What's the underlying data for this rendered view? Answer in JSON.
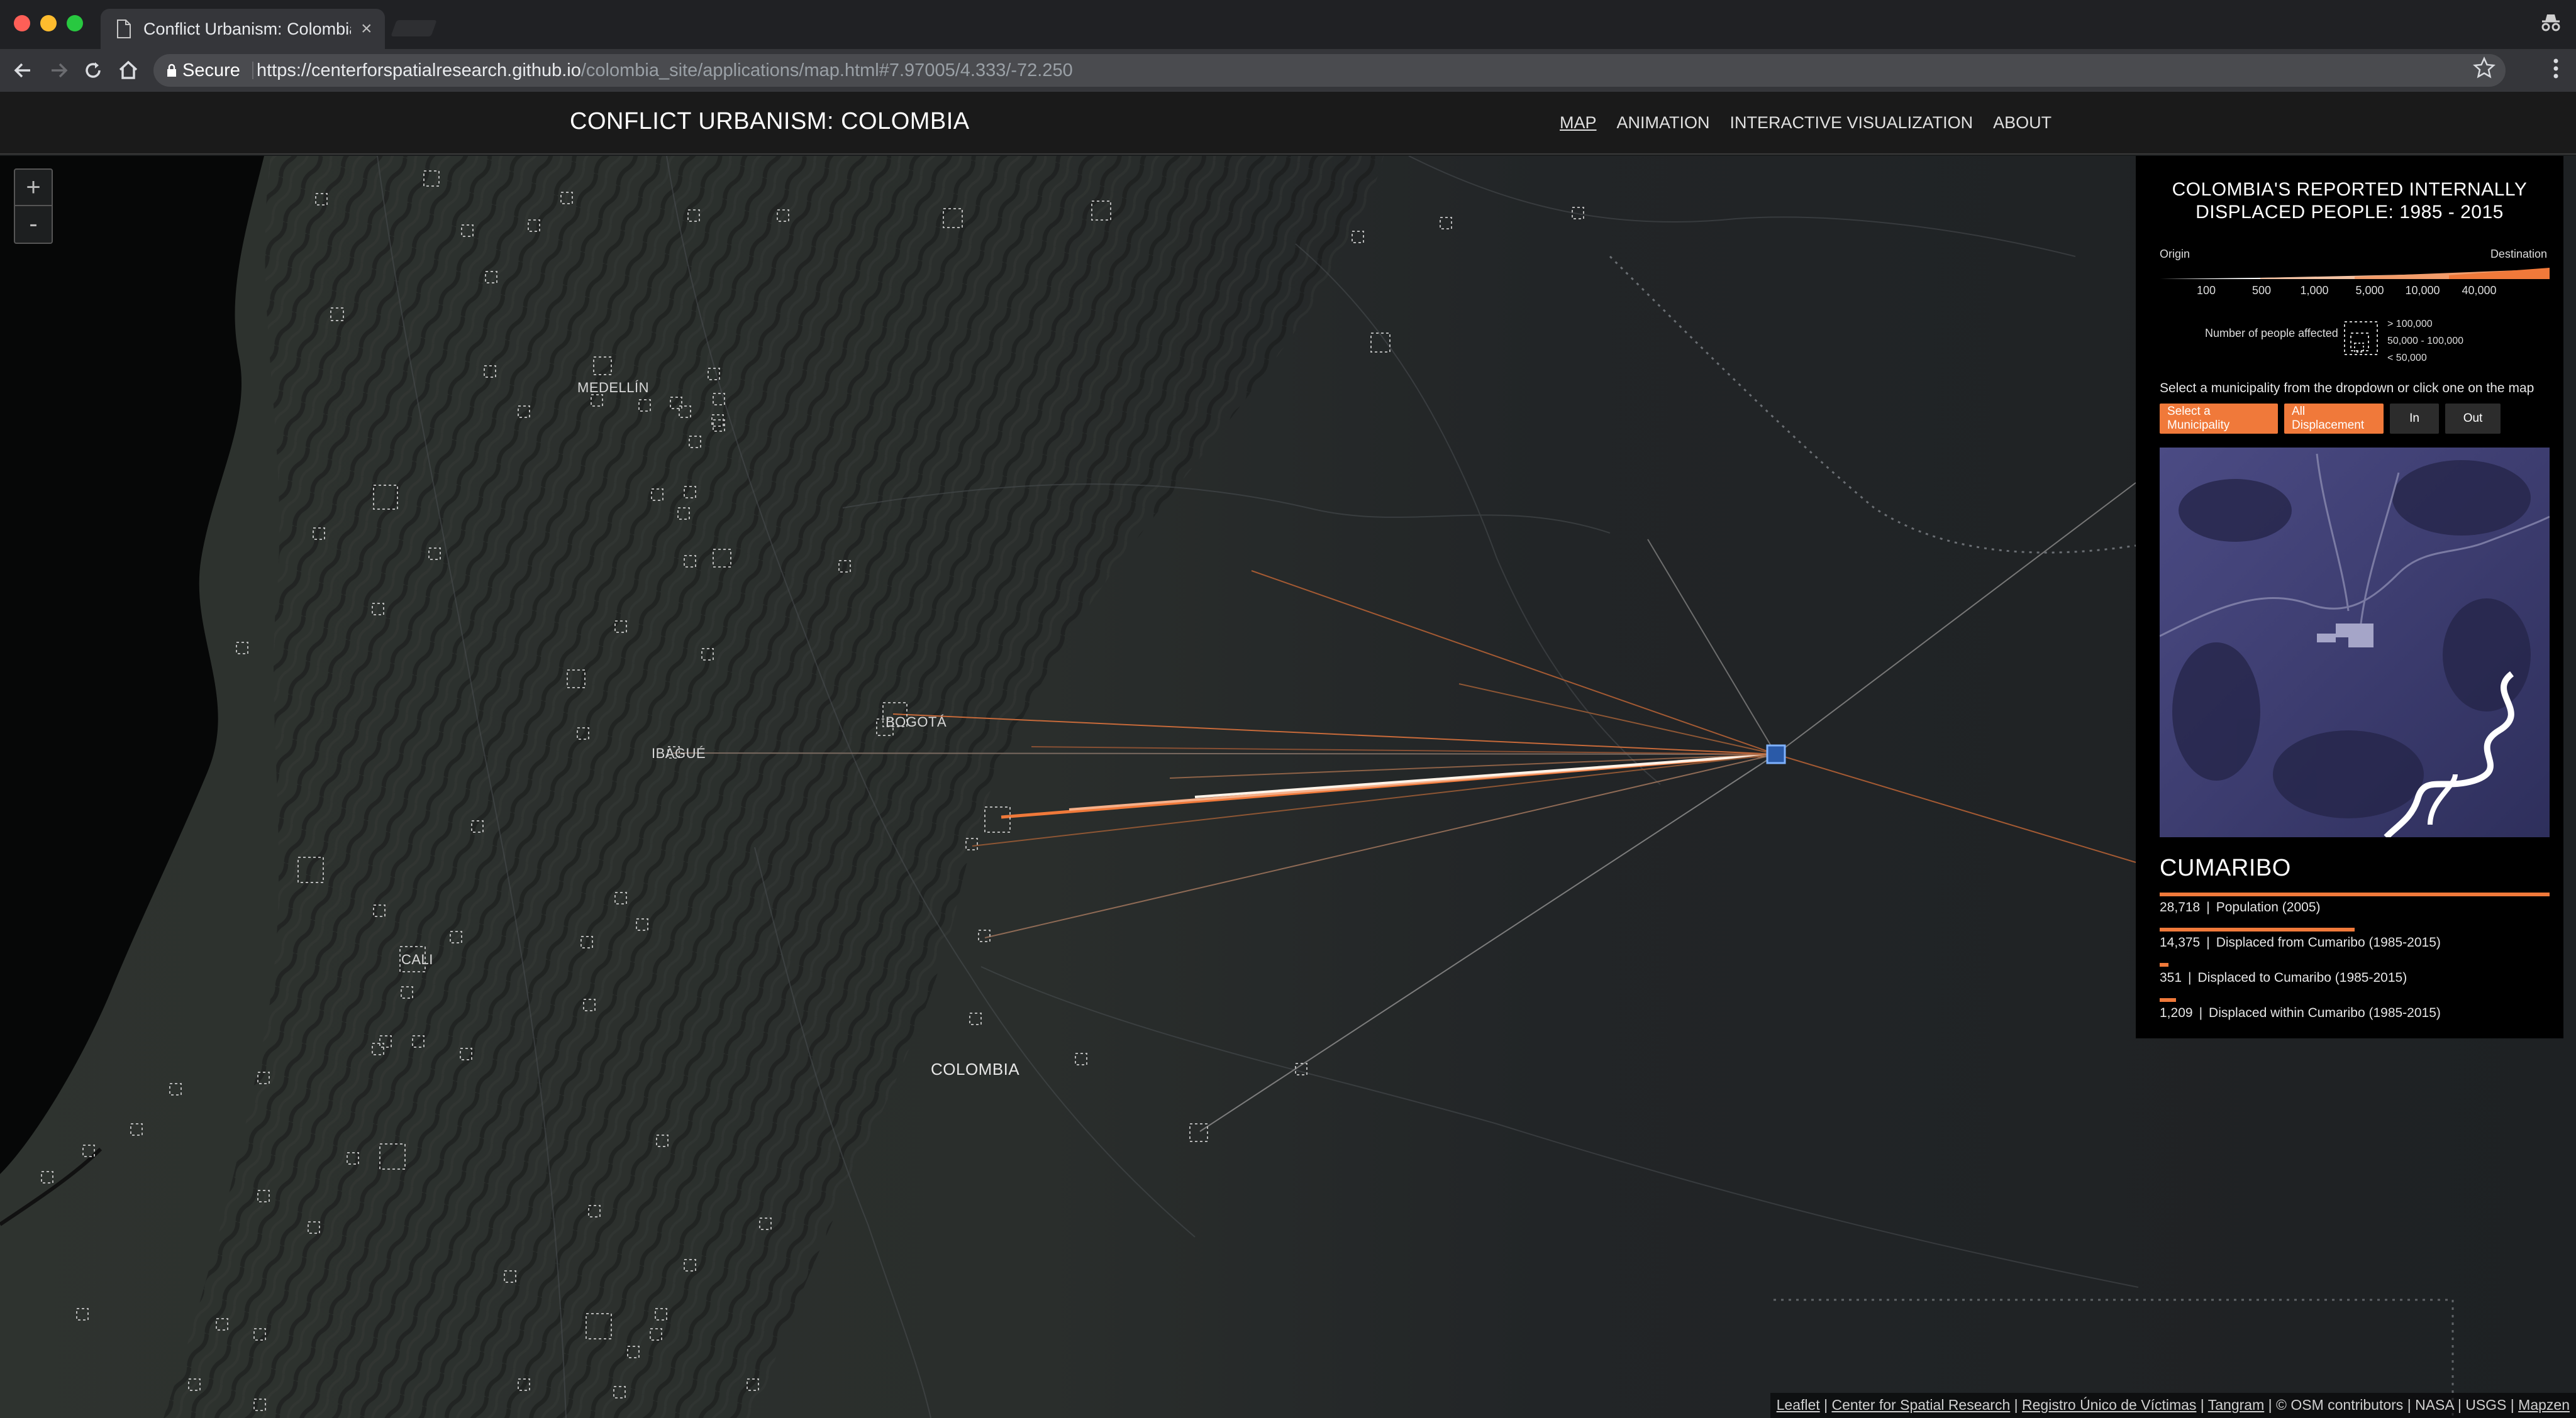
{
  "browser": {
    "tab_title": "Conflict Urbanism: Colombia",
    "tab_close": "×",
    "secure_label": "Secure",
    "url_host": "https://centerforspatialresearch.github.io",
    "url_path": "/colombia_site/applications/map.html#7.97005/4.333/-72.250"
  },
  "site": {
    "title": "CONFLICT URBANISM: COLOMBIA",
    "nav": [
      "MAP",
      "ANIMATION",
      "INTERACTIVE VISUALIZATION",
      "ABOUT"
    ],
    "active_nav": "MAP"
  },
  "map": {
    "zoom_in": "+",
    "zoom_out": "-",
    "labels": {
      "medellin": "MEDELLÍN",
      "bogota": "BOGOTÁ",
      "ibague": "IBAGUÉ",
      "cali": "CALI",
      "colombia": "COLOMBIA"
    },
    "attribution": {
      "leaflet": "Leaflet",
      "csr": "Center for Spatial Research",
      "ruv": "Registro Único de Víctimas",
      "tangram": "Tangram",
      "osm": "© OSM contributors",
      "nasa": "NASA",
      "usgs": "USGS",
      "mapzen": "Mapzen"
    }
  },
  "panel": {
    "title_line1": "COLOMBIA'S REPORTED INTERNALLY",
    "title_line2": "DISPLACED PEOPLE: 1985 - 2015",
    "legend_origin": "Origin",
    "legend_destination": "Destination",
    "legend_ticks": [
      "100",
      "500",
      "1,000",
      "5,000",
      "10,000",
      "40,000"
    ],
    "size_label": "Number of people affected",
    "size_values": [
      "> 100,000",
      "50,000 - 100,000",
      "< 50,000"
    ],
    "instruction": "Select a municipality from the dropdown or click one on the map",
    "buttons": {
      "select": "Select a Municipality",
      "all": "All Displacement",
      "in": "In",
      "out": "Out"
    },
    "municipality": "CUMARIBO",
    "stats": [
      {
        "value": "28,718",
        "label": "Population (2005)",
        "fraction": 1.0
      },
      {
        "value": "14,375",
        "label": "Displaced from Cumaribo (1985-2015)",
        "fraction": 0.5
      },
      {
        "value": "351",
        "label": "Displaced to Cumaribo (1985-2015)",
        "fraction": 0.012
      },
      {
        "value": "1,209",
        "label": "Displaced within Cumaribo (1985-2015)",
        "fraction": 0.042
      }
    ],
    "accent_color": "#f0793a"
  }
}
